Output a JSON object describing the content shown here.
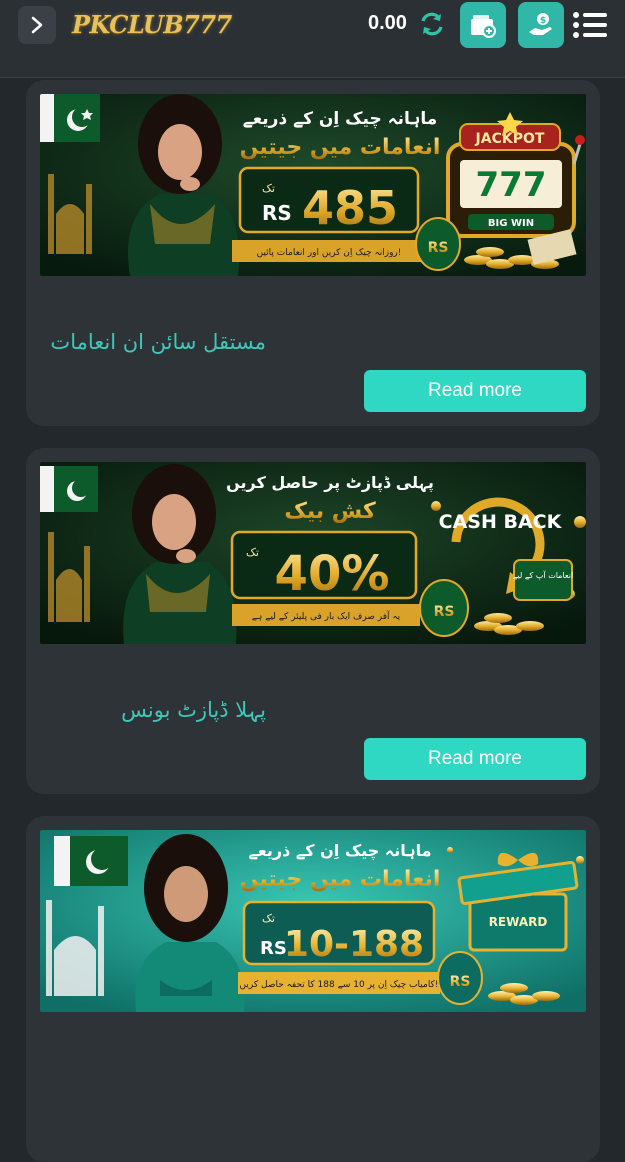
{
  "header": {
    "logo_text": "PKCLUB777",
    "balance": "0.00"
  },
  "promotions": [
    {
      "title": "مستقل سائن ان انعامات",
      "read_more": "Read more",
      "banner": {
        "line1": "ماہانہ چیک اِن کے ذریعے",
        "line2": "انعامات میں جیتیں",
        "amount": "485",
        "currency": "RS",
        "small_label": "تک",
        "ribbon": "روزانہ چیک اِن کریں اور انعامات پائیں!",
        "jackpot": "JACKPOT",
        "sevens": "777",
        "big_win": "BIG WIN",
        "bag": "RS"
      }
    },
    {
      "title": "پہلا ڈپازٹ بونس",
      "read_more": "Read more",
      "banner": {
        "line1": "پہلی ڈپازٹ پر حاصل کریں",
        "line2": "کش بیک",
        "amount": "40%",
        "small_label": "تک",
        "ribbon": "یہ آفر صرف ایک بار فی پلیئر کے لیے ہے",
        "cashback": "CASH BACK",
        "side_note": "انعامات آپ کے لیے",
        "bag": "RS"
      }
    },
    {
      "banner": {
        "line1": "ماہانہ چیک اِن کے ذریعے",
        "line2": "انعامات میں جیتیں",
        "amount": "10-188",
        "currency": "RS",
        "small_label": "تک",
        "ribbon": "کامیاب چیک اِن پر 10 سے 188 کا تحفہ حاصل کریں!",
        "reward": "REWARD",
        "bag": "RS"
      }
    }
  ]
}
